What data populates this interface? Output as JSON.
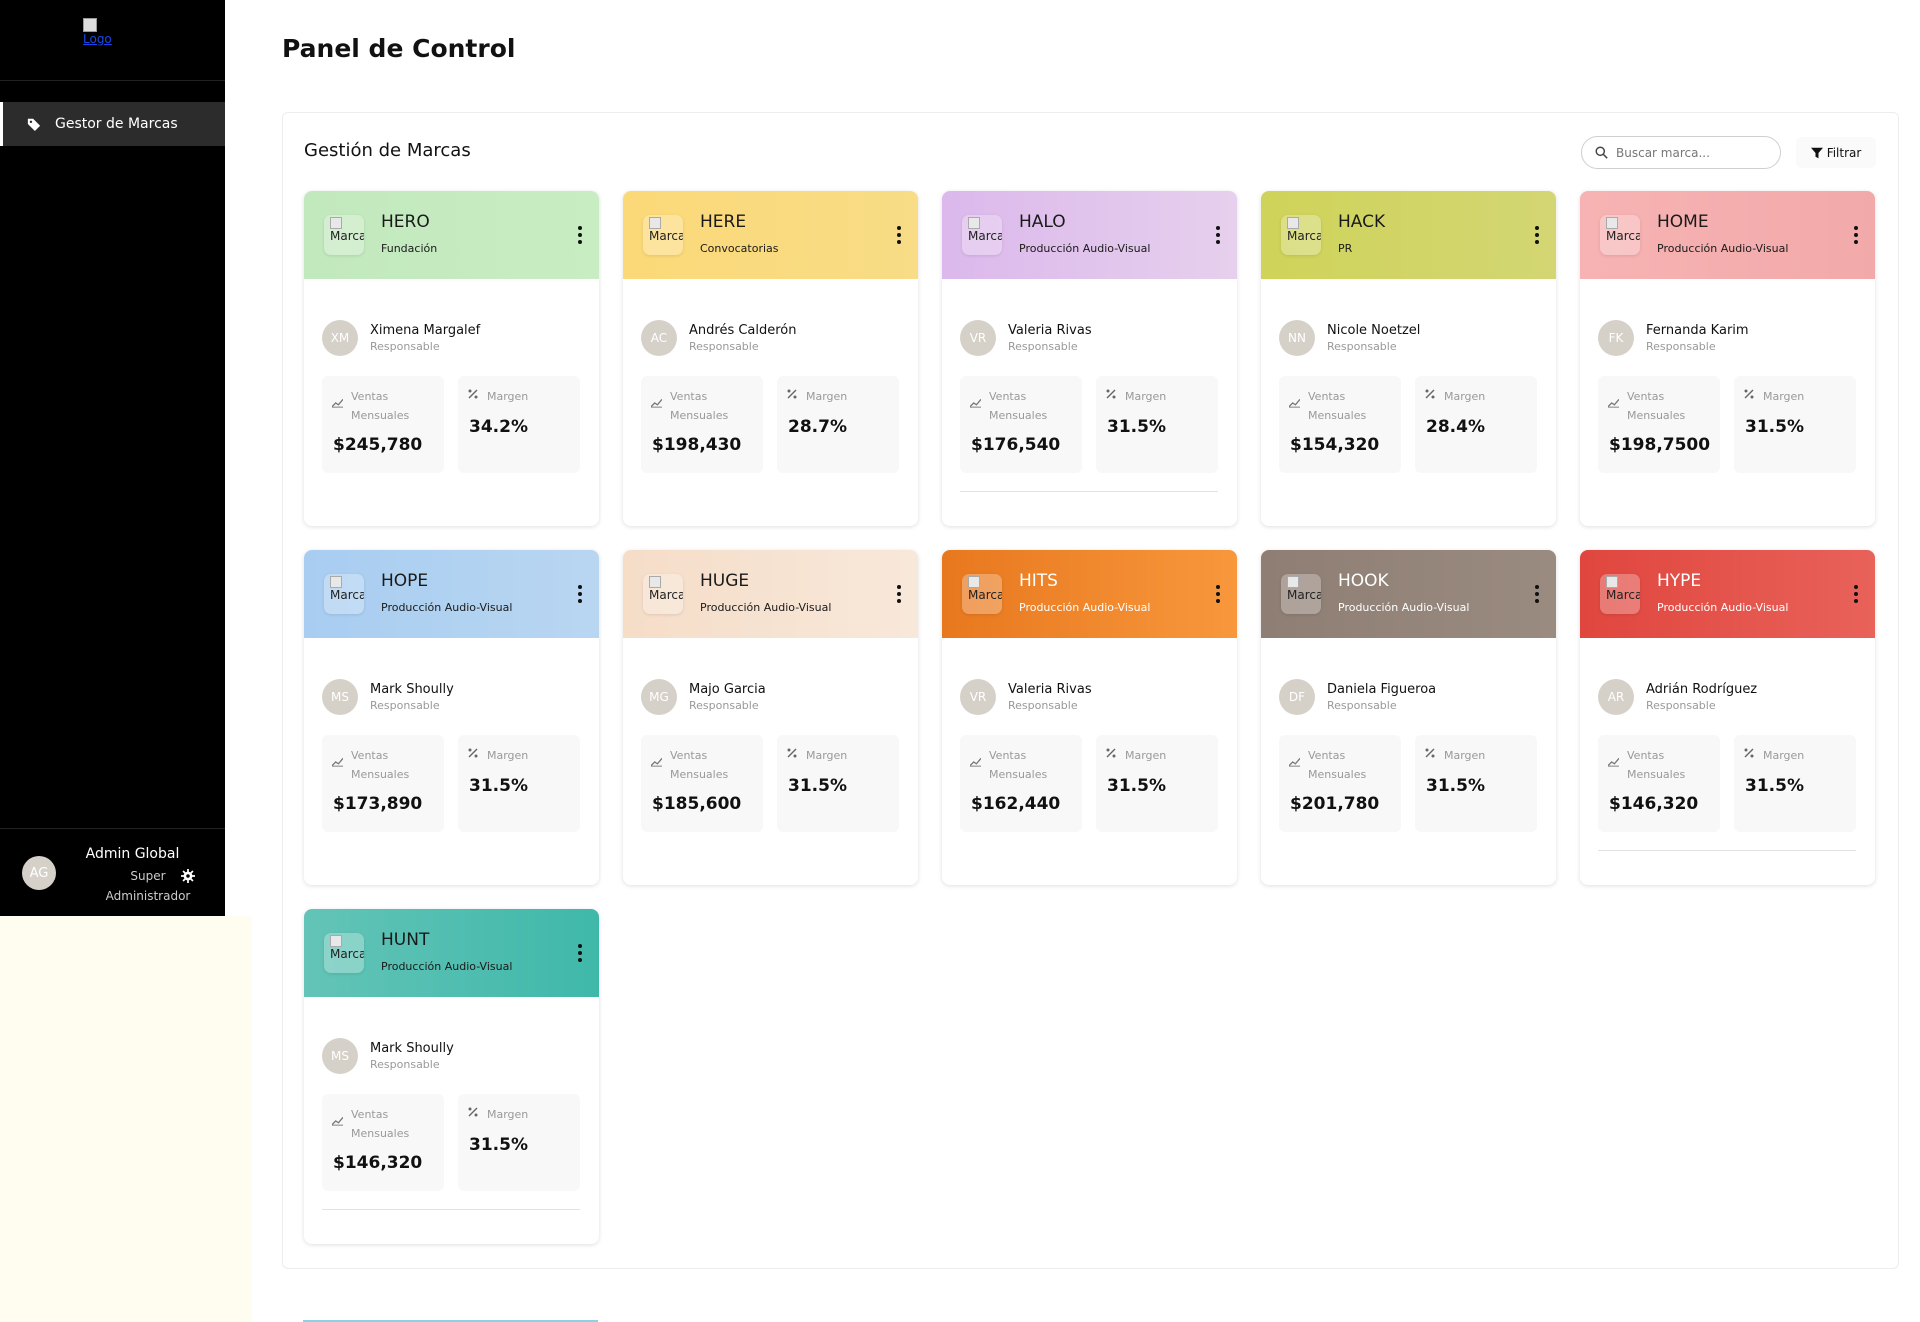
{
  "sidebar": {
    "logo_alt": "Logo",
    "nav": [
      {
        "label": "Gestor de Marcas",
        "icon": "tags-icon"
      }
    ],
    "user": {
      "initials": "AG",
      "name": "Admin Global",
      "role": "Super Administrador"
    }
  },
  "page": {
    "title": "Panel de Control"
  },
  "panel": {
    "title": "Gestión de Marcas",
    "search_placeholder": "Buscar marca...",
    "filter_label": "Filtrar",
    "responsable_label": "Responsable",
    "sales_label": "Ventas Mensuales",
    "margin_label": "Margen",
    "logo_alt": "Marca"
  },
  "brands": [
    {
      "name": "HERO",
      "category": "Fundación",
      "initials": "XM",
      "person": "Ximena Margalef",
      "sales": "$245,780",
      "margin": "34.2%",
      "bg": "linear-gradient(90deg,#c2e8bd,#c9edc3)",
      "theme": "light"
    },
    {
      "name": "HERE",
      "category": "Convocatorias",
      "initials": "AC",
      "person": "Andrés Calderón",
      "sales": "$198,430",
      "margin": "28.7%",
      "bg": "linear-gradient(90deg,#fbd978,#f8dc86)",
      "theme": "light"
    },
    {
      "name": "HALO",
      "category": "Producción Audio-Visual",
      "initials": "VR",
      "person": "Valeria Rivas",
      "sales": "$176,540",
      "margin": "31.5%",
      "bg": "linear-gradient(90deg,#dcb8ec,#e6d0ed)",
      "theme": "light"
    },
    {
      "name": "HACK",
      "category": "PR",
      "initials": "NN",
      "person": "Nicole Noetzel",
      "sales": "$154,320",
      "margin": "28.4%",
      "bg": "linear-gradient(90deg,#cfd359,#d3d673)",
      "theme": "light"
    },
    {
      "name": "HOME",
      "category": "Producción Audio-Visual",
      "initials": "FK",
      "person": "Fernanda Karim",
      "sales": "$198,7500",
      "margin": "31.5%",
      "bg": "linear-gradient(90deg,#f7b3b3,#f2a9aa)",
      "theme": "light"
    },
    {
      "name": "HOPE",
      "category": "Producción Audio-Visual",
      "initials": "MS",
      "person": "Mark Shoully",
      "sales": "$173,890",
      "margin": "31.5%",
      "bg": "linear-gradient(90deg,#a8cdf1,#b9d6f1)",
      "theme": "light"
    },
    {
      "name": "HUGE",
      "category": "Producción Audio-Visual",
      "initials": "MG",
      "person": "Majo Garcia",
      "sales": "$185,600",
      "margin": "31.5%",
      "bg": "linear-gradient(90deg,#f5ddc8,#f8e8da)",
      "theme": "light"
    },
    {
      "name": "HITS",
      "category": "Producción Audio-Visual",
      "initials": "VR",
      "person": "Valeria Rivas",
      "sales": "$162,440",
      "margin": "31.5%",
      "bg": "linear-gradient(90deg,#e8781e,#f8973c)",
      "theme": "dark"
    },
    {
      "name": "HOOK",
      "category": "Producción Audio-Visual",
      "initials": "DF",
      "person": "Daniela Figueroa",
      "sales": "$201,780",
      "margin": "31.5%",
      "bg": "linear-gradient(90deg,#8e7e74,#9a8b80)",
      "theme": "dark"
    },
    {
      "name": "HYPE",
      "category": "Producción Audio-Visual",
      "initials": "AR",
      "person": "Adrián Rodríguez",
      "sales": "$146,320",
      "margin": "31.5%",
      "bg": "linear-gradient(90deg,#e0463e,#e8625a)",
      "theme": "dark"
    },
    {
      "name": "HUNT",
      "category": "Producción Audio-Visual",
      "initials": "MS",
      "person": "Mark Shoully",
      "sales": "$146,320",
      "margin": "31.5%",
      "bg": "linear-gradient(90deg,#63c4b7,#3fb8aa)",
      "theme": "light"
    }
  ],
  "colors": {
    "sidebar_bg": "#000000",
    "avatar_bg": "#d6d1c8",
    "stat_bg": "#f8f8f8"
  }
}
